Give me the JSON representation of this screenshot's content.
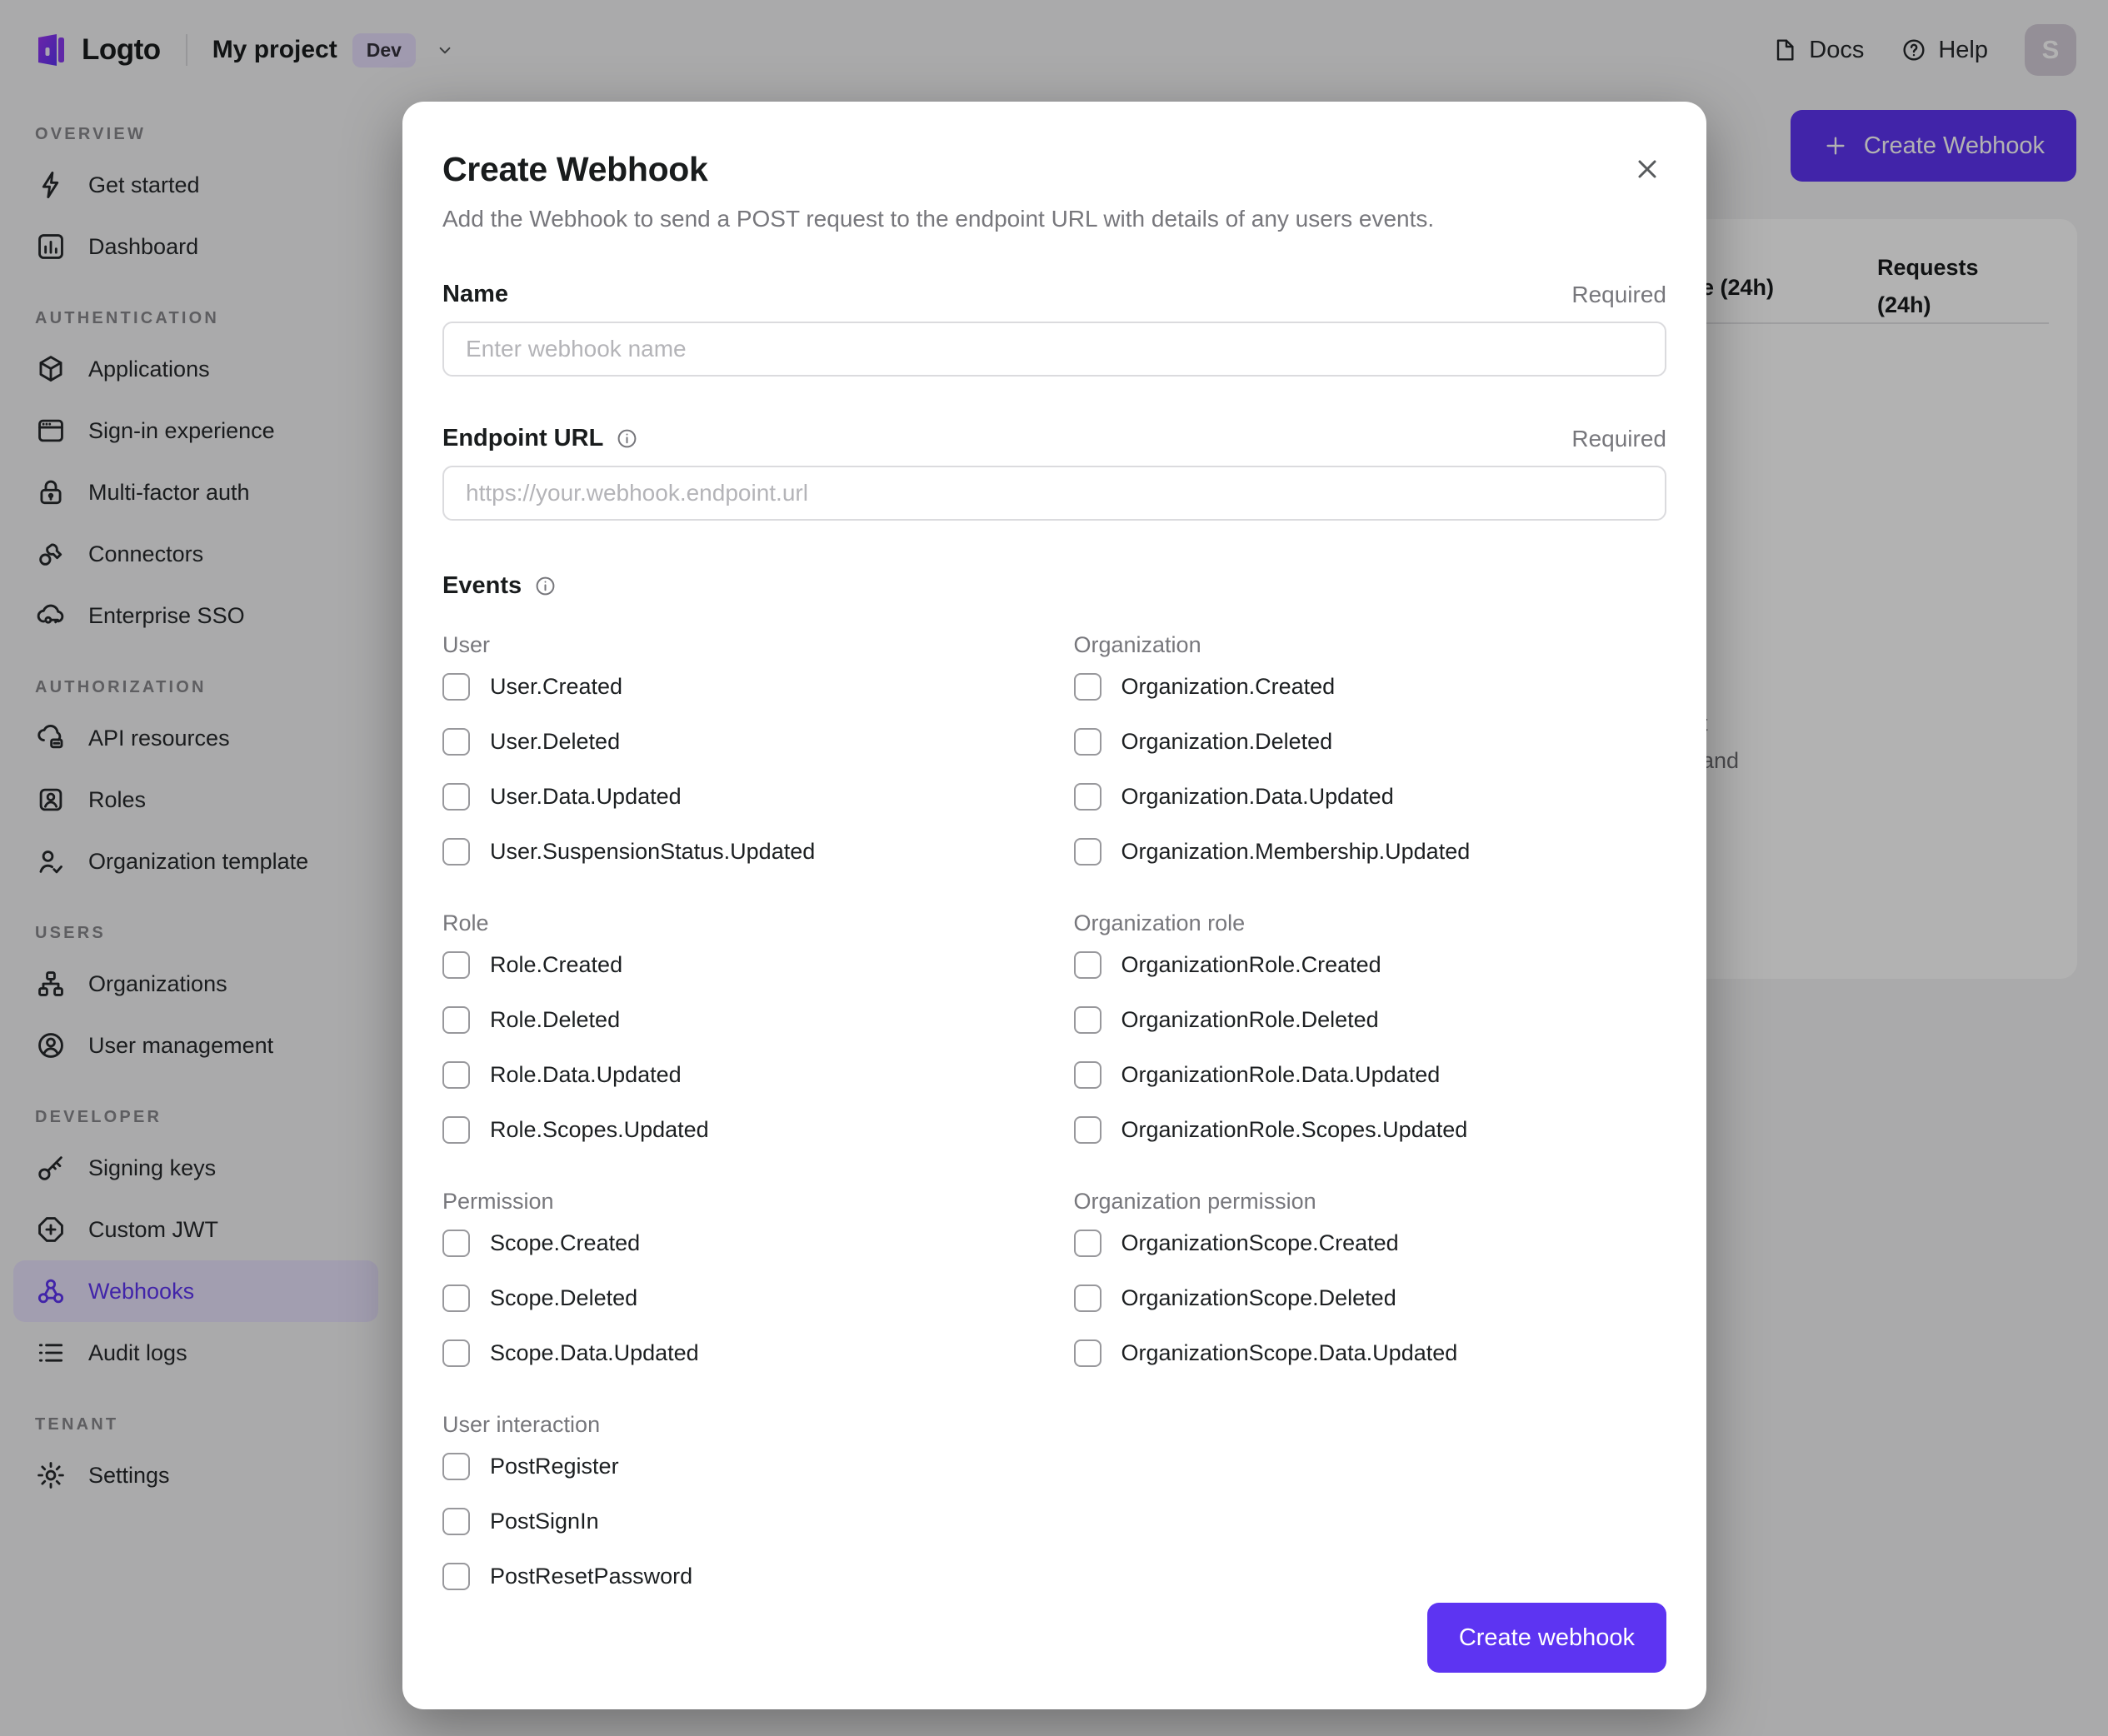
{
  "colors": {
    "accent": "#5d34f2",
    "accent_soft": "#e9e2fc",
    "page_bg": "#f4f4f5",
    "card": "#ffffff",
    "overlay": "rgba(0,0,0,0.3)"
  },
  "header": {
    "brand": "Logto",
    "project_name": "My project",
    "env_badge": "Dev",
    "docs_label": "Docs",
    "help_label": "Help",
    "avatar_letter": "S"
  },
  "sidebar": {
    "sections": [
      {
        "label": "OVERVIEW",
        "items": [
          {
            "label": "Get started",
            "icon": "get-started-icon"
          },
          {
            "label": "Dashboard",
            "icon": "dashboard-icon"
          }
        ]
      },
      {
        "label": "AUTHENTICATION",
        "items": [
          {
            "label": "Applications",
            "icon": "applications-icon"
          },
          {
            "label": "Sign-in experience",
            "icon": "sign-in-icon"
          },
          {
            "label": "Multi-factor auth",
            "icon": "mfa-lock-icon"
          },
          {
            "label": "Connectors",
            "icon": "connectors-icon"
          },
          {
            "label": "Enterprise SSO",
            "icon": "enterprise-sso-icon"
          }
        ]
      },
      {
        "label": "AUTHORIZATION",
        "items": [
          {
            "label": "API resources",
            "icon": "api-resources-icon"
          },
          {
            "label": "Roles",
            "icon": "roles-icon"
          },
          {
            "label": "Organization template",
            "icon": "org-template-icon"
          }
        ]
      },
      {
        "label": "USERS",
        "items": [
          {
            "label": "Organizations",
            "icon": "organizations-icon"
          },
          {
            "label": "User management",
            "icon": "user-management-icon"
          }
        ]
      },
      {
        "label": "DEVELOPER",
        "items": [
          {
            "label": "Signing keys",
            "icon": "signing-keys-icon"
          },
          {
            "label": "Custom JWT",
            "icon": "custom-jwt-icon"
          },
          {
            "label": "Webhooks",
            "icon": "webhooks-icon",
            "active": true
          },
          {
            "label": "Audit logs",
            "icon": "audit-logs-icon"
          }
        ]
      },
      {
        "label": "TENANT",
        "items": [
          {
            "label": "Settings",
            "icon": "settings-gear-icon"
          }
        ]
      }
    ]
  },
  "background": {
    "create_button_label": "Create Webhook",
    "table_header_fragment": "e (24h)",
    "table_header_requests_line1": "Requests",
    "table_header_requests_line2": "(24h)",
    "empty_fragment_1": "t",
    "empty_fragment_2": "and"
  },
  "modal": {
    "title": "Create Webhook",
    "subtitle": "Add the Webhook to send a POST request to the endpoint URL with details of any users events.",
    "name_field": {
      "label": "Name",
      "required": "Required",
      "placeholder": "Enter webhook name"
    },
    "endpoint_field": {
      "label": "Endpoint URL",
      "required": "Required",
      "placeholder": "https://your.webhook.endpoint.url"
    },
    "events_label": "Events",
    "groups": [
      {
        "left": {
          "title": "User",
          "items": [
            "User.Created",
            "User.Deleted",
            "User.Data.Updated",
            "User.SuspensionStatus.Updated"
          ]
        },
        "right": {
          "title": "Organization",
          "items": [
            "Organization.Created",
            "Organization.Deleted",
            "Organization.Data.Updated",
            "Organization.Membership.Updated"
          ]
        }
      },
      {
        "left": {
          "title": "Role",
          "items": [
            "Role.Created",
            "Role.Deleted",
            "Role.Data.Updated",
            "Role.Scopes.Updated"
          ]
        },
        "right": {
          "title": "Organization role",
          "items": [
            "OrganizationRole.Created",
            "OrganizationRole.Deleted",
            "OrganizationRole.Data.Updated",
            "OrganizationRole.Scopes.Updated"
          ]
        }
      },
      {
        "left": {
          "title": "Permission",
          "items": [
            "Scope.Created",
            "Scope.Deleted",
            "Scope.Data.Updated"
          ]
        },
        "right": {
          "title": "Organization permission",
          "items": [
            "OrganizationScope.Created",
            "OrganizationScope.Deleted",
            "OrganizationScope.Data.Updated"
          ]
        }
      },
      {
        "left": {
          "title": "User interaction",
          "items": [
            "PostRegister",
            "PostSignIn",
            "PostResetPassword"
          ]
        },
        "right": null
      }
    ],
    "submit_label": "Create webhook"
  }
}
